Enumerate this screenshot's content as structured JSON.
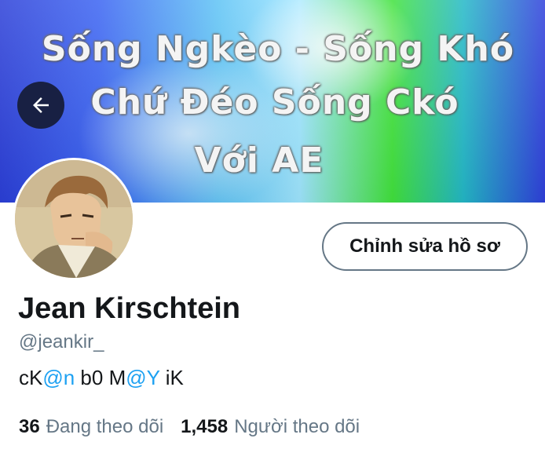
{
  "banner": {
    "lines": [
      "Sống Ngkèo - Sống Khó",
      "Chứ Đéo Sống Ckó",
      "Với AE"
    ]
  },
  "profile": {
    "edit_button_label": "Chỉnh sửa hồ sơ",
    "name": "Jean Kirschtein",
    "handle": "@jeankir_",
    "bio": {
      "part1": "cK",
      "mention1": "@n",
      "part2": " b0 M",
      "mention2": "@Y",
      "part3": " iK"
    },
    "stats": {
      "following_count": "36",
      "following_label": "Đang theo dõi",
      "followers_count": "1,458",
      "followers_label": "Người theo dõi"
    }
  },
  "colors": {
    "accent": "#1da1f2",
    "secondary_text": "#657786",
    "back_button_bg": "#182043"
  },
  "icons": {
    "back": "arrow-left-icon"
  }
}
